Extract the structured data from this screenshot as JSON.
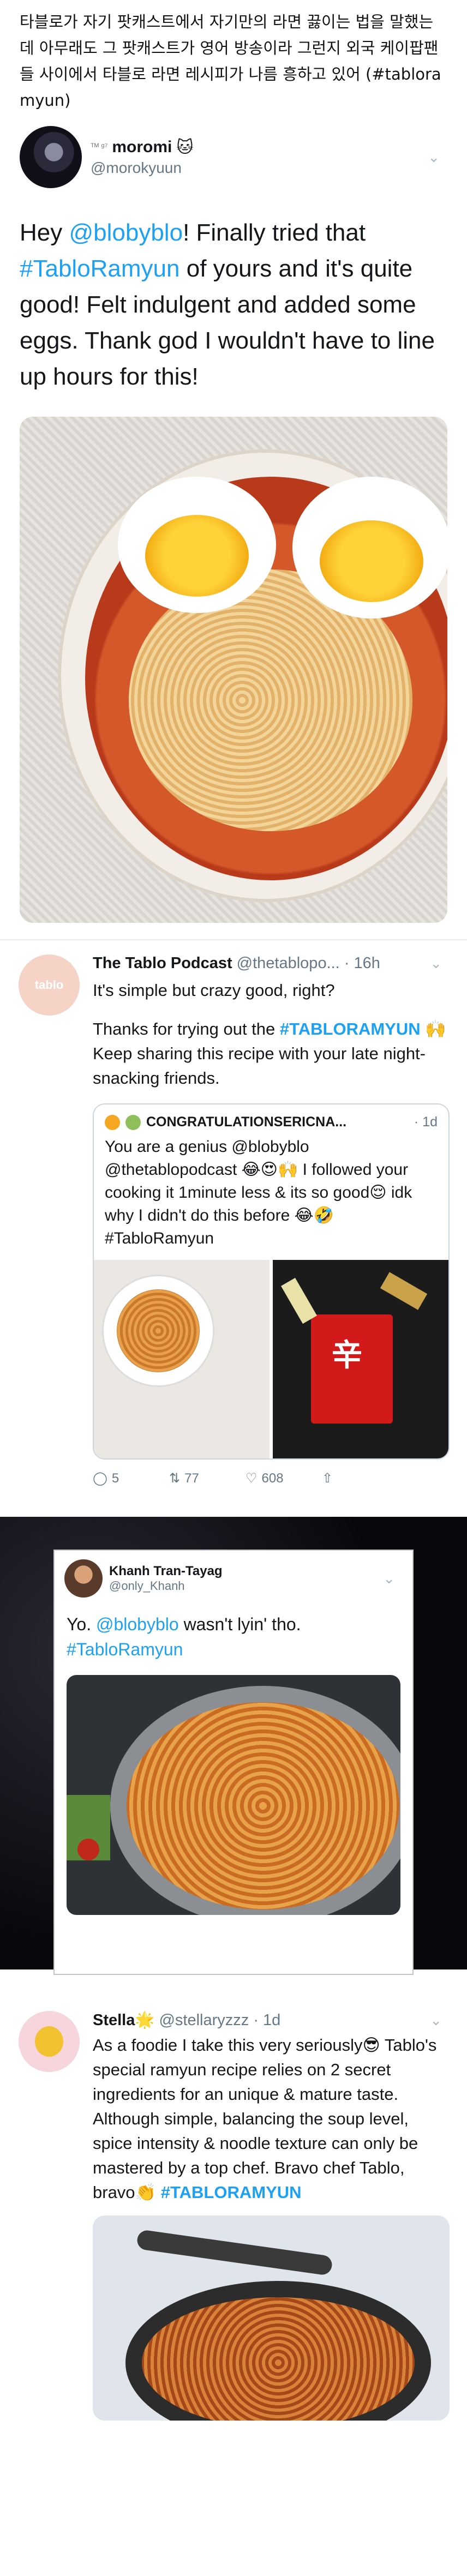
{
  "korean_caption": "타블로가 자기 팟캐스트에서 자기만의 라면 끓이는 법을 말했는데 아무래도 그 팟캐스트가 영어 방송이라 그런지 외국 케이팝팬들 사이에서 타블로 라면 레시피가 나름 흥하고 있어 (#tabloramyun)",
  "tweet1": {
    "tag": "ᵀᴹ ᵍ⁷",
    "name": "moromi",
    "name_emoji": "🐱",
    "handle": "@morokyuun",
    "text_pre": "Hey ",
    "mention": "@blobyblo",
    "text_mid": "! Finally tried that ",
    "hashtag": "#TabloRamyun",
    "text_post": " of yours and it's quite good! Felt indulgent and added some eggs. Thank god I wouldn't have to line up hours for this!"
  },
  "podcast": {
    "avatar_text": "tablo",
    "name": "The Tablo Podcast",
    "handle_time": "@thetablopo... · 16h",
    "text1": "It's simple but crazy good, right?",
    "text2_pre": "Thanks for trying out the ",
    "hashtag": "#TABLORAMYUN",
    "text2_post": " 🙌 Keep sharing this recipe with your late night-snacking friends.",
    "quote": {
      "name": "CONGRATULATIONSERICNA...",
      "date": "· 1d",
      "text": "You are a genius @blobyblo @thetablopodcast 😂😍🙌 I followed your cooking it 1minute less & its so good😌 idk why I didn't do this before 😂🤣 #TabloRamyun",
      "pkg_label": "辛"
    },
    "actions": {
      "replies": "5",
      "retweets": "77",
      "likes": "608"
    }
  },
  "khanh": {
    "name": "Khanh Tran-Tayag",
    "handle": "@only_Khanh",
    "text_pre": "Yo. ",
    "mention": "@blobyblo",
    "text_post": " wasn't lyin' tho.",
    "hashtag": "#TabloRamyun"
  },
  "stella": {
    "name": "Stella",
    "name_emoji": "🌟",
    "handle_time": "@stellaryzzz · 1d",
    "text": "As a foodie I take this very seriously😎 Tablo's special ramyun recipe relies on 2 secret ingredients for an unique & mature taste. Although simple, balancing the soup level, spice intensity & noodle texture can only be mastered by a top chef. Bravo chef Tablo, bravo👏 ",
    "hashtag": "#TABLORAMYUN"
  },
  "icons": {
    "chevron": "chevron-down-icon",
    "reply": "reply-icon",
    "retweet": "retweet-icon",
    "like": "heart-icon",
    "share": "share-icon"
  },
  "colors": {
    "link": "#1da1f2",
    "muted": "#657786",
    "border": "#e6ecf0"
  }
}
